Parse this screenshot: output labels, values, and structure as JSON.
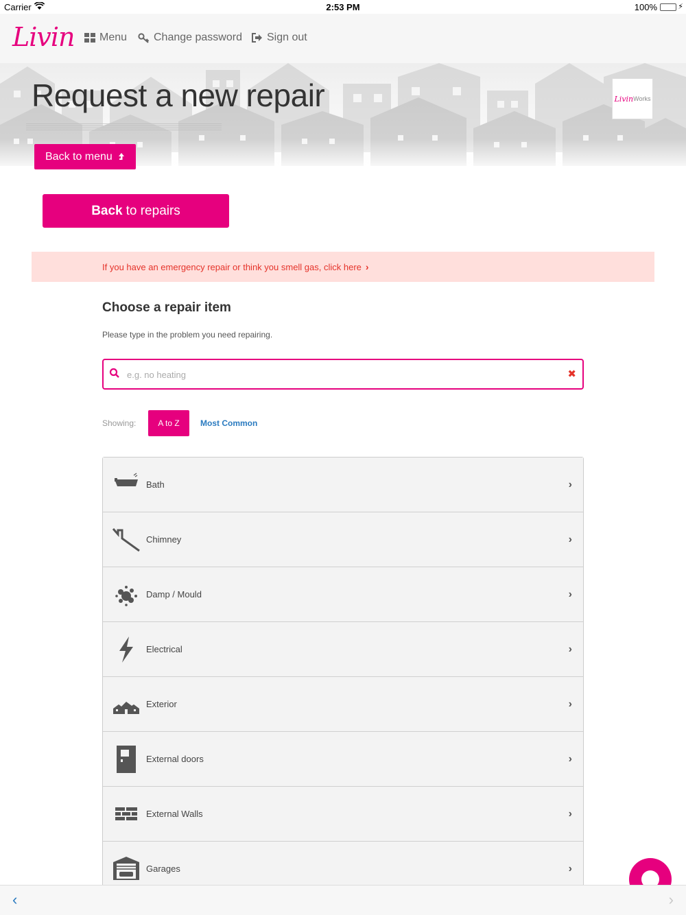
{
  "status_bar": {
    "carrier": "Carrier",
    "time": "2:53 PM",
    "battery": "100%"
  },
  "nav": {
    "logo": "Livin",
    "menu": "Menu",
    "change_password": "Change password",
    "sign_out": "Sign out"
  },
  "hero": {
    "title": "Request a new repair",
    "partner_logo_script": "Livin",
    "partner_logo_text": "Works",
    "back_to_menu": "Back to menu"
  },
  "back_repairs": {
    "bold": "Back",
    "rest": "to repairs"
  },
  "emergency_text": "If you have an emergency repair or think you smell gas, click here",
  "section": {
    "title": "Choose a repair item",
    "subtitle": "Please type in the problem you need repairing."
  },
  "search": {
    "placeholder": "e.g. no heating",
    "value": ""
  },
  "filter": {
    "label": "Showing:",
    "atoz": "A to Z",
    "common": "Most Common",
    "active": "A to Z"
  },
  "repair_items": [
    {
      "label": "Bath",
      "icon": "bath-icon"
    },
    {
      "label": "Chimney",
      "icon": "chimney-icon"
    },
    {
      "label": "Damp / Mould",
      "icon": "damp-icon"
    },
    {
      "label": "Electrical",
      "icon": "lightning-icon"
    },
    {
      "label": "Exterior",
      "icon": "houses-icon"
    },
    {
      "label": "External doors",
      "icon": "door-icon"
    },
    {
      "label": "External Walls",
      "icon": "bricks-icon"
    },
    {
      "label": "Garages",
      "icon": "garage-icon"
    }
  ],
  "colors": {
    "brand": "#e6007e",
    "alert_bg": "#ffdfdc",
    "alert_text": "#e5332a",
    "link": "#2b7bc0"
  }
}
